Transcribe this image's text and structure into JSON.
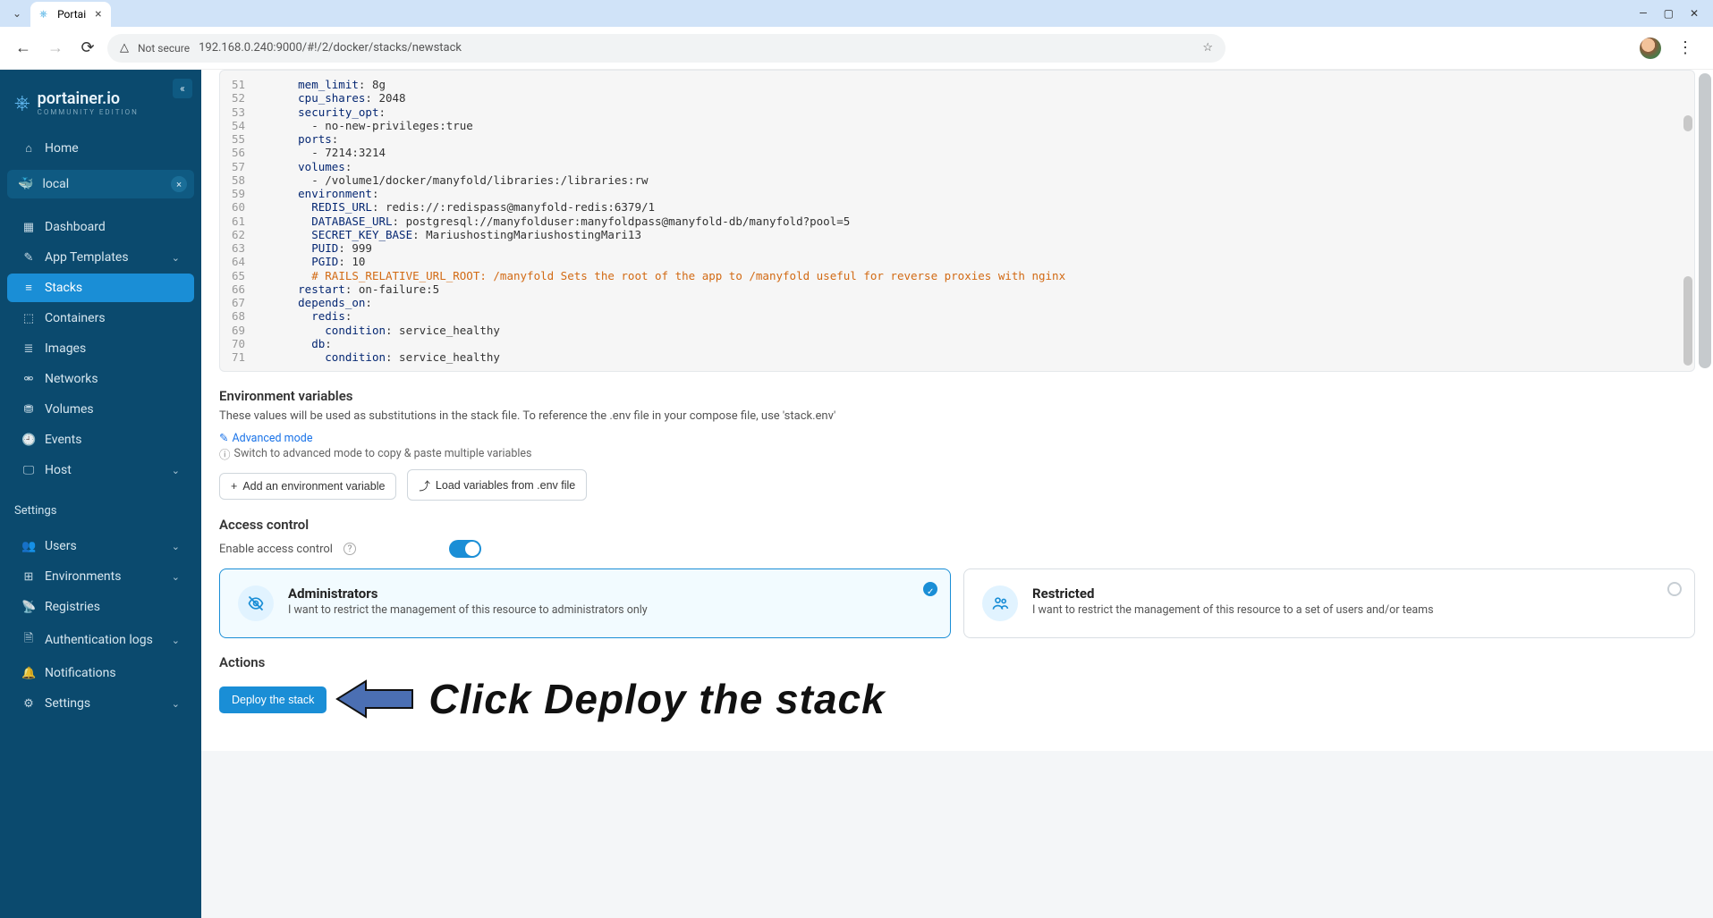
{
  "browser": {
    "tab_title": "Portai",
    "url": "192.168.0.240:9000/#!/2/docker/stacks/newstack",
    "not_secure": "Not secure"
  },
  "brand": {
    "name": "portainer.io",
    "edition": "COMMUNITY EDITION"
  },
  "nav": {
    "home": "Home",
    "env": "local",
    "items": [
      {
        "label": "Dashboard",
        "icon": "▦",
        "expandable": false
      },
      {
        "label": "App Templates",
        "icon": "✎",
        "expandable": true
      },
      {
        "label": "Stacks",
        "icon": "≡",
        "active": true
      },
      {
        "label": "Containers",
        "icon": "⬚",
        "expandable": false
      },
      {
        "label": "Images",
        "icon": "≣",
        "expandable": false
      },
      {
        "label": "Networks",
        "icon": "�alaalaala",
        "icon2": "↔",
        "expandable": false
      },
      {
        "label": "Volumes",
        "icon": "⛃",
        "expandable": false
      },
      {
        "label": "Events",
        "icon": "⏱",
        "expandable": false
      },
      {
        "label": "Host",
        "icon": "▭",
        "expandable": true
      }
    ],
    "settings_label": "Settings",
    "settings": [
      {
        "label": "Users",
        "icon": "👥",
        "expandable": true
      },
      {
        "label": "Environments",
        "icon": "⊞",
        "expandable": true
      },
      {
        "label": "Registries",
        "icon": "📡",
        "expandable": false
      },
      {
        "label": "Authentication logs",
        "icon": "🗎",
        "expandable": true
      },
      {
        "label": "Notifications",
        "icon": "🔔",
        "expandable": false
      },
      {
        "label": "Settings",
        "icon": "⚙",
        "expandable": true
      }
    ]
  },
  "code": [
    {
      "n": 51,
      "indent": 6,
      "key": "mem_limit",
      "val": " 8g"
    },
    {
      "n": 52,
      "indent": 6,
      "key": "cpu_shares",
      "val": " 2048"
    },
    {
      "n": 53,
      "indent": 6,
      "key": "security_opt",
      "val": ""
    },
    {
      "n": 54,
      "indent": 8,
      "plain": "- no-new-privileges:true"
    },
    {
      "n": 55,
      "indent": 6,
      "key": "ports",
      "val": ""
    },
    {
      "n": 56,
      "indent": 8,
      "plain": "- 7214:3214"
    },
    {
      "n": 57,
      "indent": 6,
      "key": "volumes",
      "val": ""
    },
    {
      "n": 58,
      "indent": 8,
      "plain": "- /volume1/docker/manyfold/libraries:/libraries:rw"
    },
    {
      "n": 59,
      "indent": 6,
      "key": "environment",
      "val": ""
    },
    {
      "n": 60,
      "indent": 8,
      "key": "REDIS_URL",
      "val": " redis://:redispass@manyfold-redis:6379/1"
    },
    {
      "n": 61,
      "indent": 8,
      "key": "DATABASE_URL",
      "val": " postgresql://manyfolduser:manyfoldpass@manyfold-db/manyfold?pool=5"
    },
    {
      "n": 62,
      "indent": 8,
      "key": "SECRET_KEY_BASE",
      "val": " MariushostingMariushostingMari13"
    },
    {
      "n": 63,
      "indent": 8,
      "key": "PUID",
      "val": " 999"
    },
    {
      "n": 64,
      "indent": 8,
      "key": "PGID",
      "val": " 10"
    },
    {
      "n": 65,
      "indent": 8,
      "comment": "# RAILS_RELATIVE_URL_ROOT: /manyfold Sets the root of the app to /manyfold useful for reverse proxies with nginx"
    },
    {
      "n": 66,
      "indent": 6,
      "key": "restart",
      "val": " on-failure:5"
    },
    {
      "n": 67,
      "indent": 6,
      "key": "depends_on",
      "val": ""
    },
    {
      "n": 68,
      "indent": 8,
      "key": "redis",
      "val": ""
    },
    {
      "n": 69,
      "indent": 10,
      "key": "condition",
      "val": " service_healthy"
    },
    {
      "n": 70,
      "indent": 8,
      "key": "db",
      "val": ""
    },
    {
      "n": 71,
      "indent": 10,
      "key": "condition",
      "val": " service_healthy"
    }
  ],
  "env": {
    "title": "Environment variables",
    "help": "These values will be used as substitutions in the stack file. To reference the .env file in your compose file, use 'stack.env'",
    "advanced": "Advanced mode",
    "switch_hint": "Switch to advanced mode to copy & paste multiple variables",
    "add_btn": "Add an environment variable",
    "load_btn": "Load variables from .env file"
  },
  "access": {
    "title": "Access control",
    "enable": "Enable access control",
    "admin": {
      "title": "Administrators",
      "desc": "I want to restrict the management of this resource to administrators only"
    },
    "restricted": {
      "title": "Restricted",
      "desc": "I want to restrict the management of this resource to a set of users and/or teams"
    }
  },
  "actions": {
    "title": "Actions",
    "deploy": "Deploy the stack"
  },
  "annotation": "Click Deploy the stack"
}
